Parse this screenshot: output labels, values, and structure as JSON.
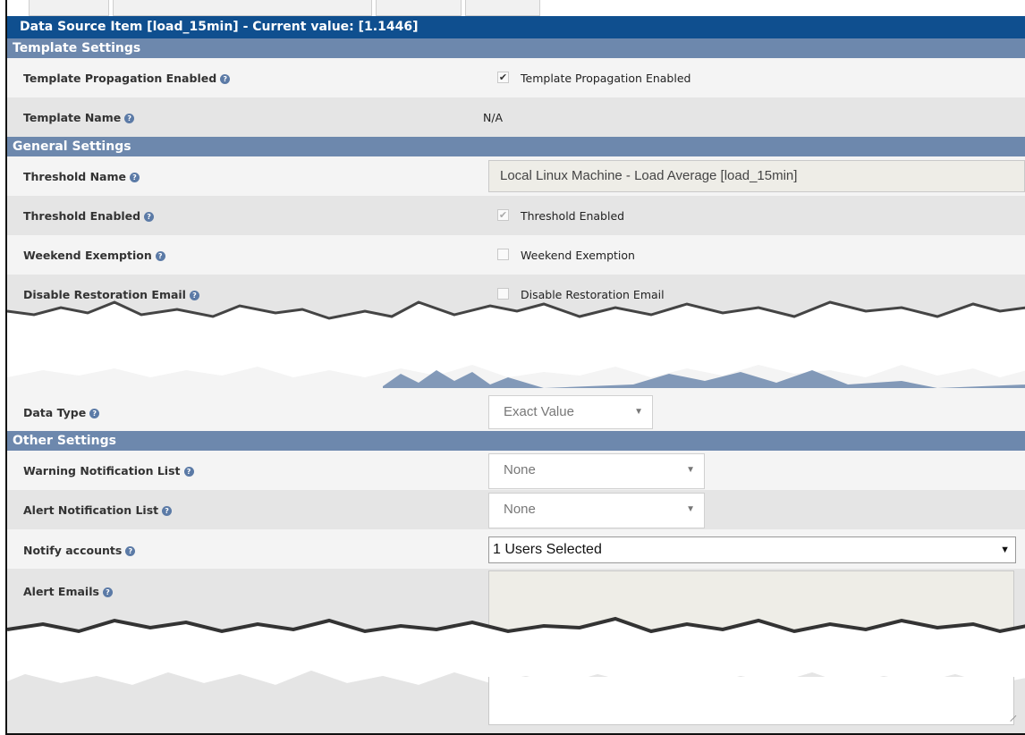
{
  "title_bar": "Data Source Item [load_15min] - Current value: [1.1446]",
  "sections": {
    "template": "Template Settings",
    "general": "General Settings",
    "other": "Other Settings"
  },
  "fields": {
    "template_propagation": {
      "label": "Template Propagation Enabled",
      "checkbox_label": "Template Propagation Enabled",
      "checked": true
    },
    "template_name": {
      "label": "Template Name",
      "value": "N/A"
    },
    "threshold_name": {
      "label": "Threshold Name",
      "value": "Local Linux Machine - Load Average [load_15min]"
    },
    "threshold_enabled": {
      "label": "Threshold Enabled",
      "checkbox_label": "Threshold Enabled",
      "checked": true
    },
    "weekend_exemption": {
      "label": "Weekend Exemption",
      "checkbox_label": "Weekend Exemption",
      "checked": false
    },
    "disable_restoration": {
      "label": "Disable Restoration Email",
      "checkbox_label": "Disable Restoration Email",
      "checked": false
    },
    "data_type": {
      "label": "Data Type",
      "value": "Exact Value"
    },
    "warning_notification": {
      "label": "Warning Notification List",
      "value": "None"
    },
    "alert_notification": {
      "label": "Alert Notification List",
      "value": "None"
    },
    "notify_accounts": {
      "label": "Notify accounts",
      "value": "1 Users Selected"
    },
    "alert_emails": {
      "label": "Alert Emails",
      "value": ""
    }
  },
  "icons": {
    "help": "help-circle-icon",
    "check": "checkmark-icon",
    "dropdown": "chevron-down-icon"
  },
  "colors": {
    "title_bar": "#0f4f8f",
    "section_header": "#6d88ad",
    "row_light": "#f4f4f4",
    "row_dark": "#e5e5e5",
    "readonly_field": "#eeede7"
  }
}
